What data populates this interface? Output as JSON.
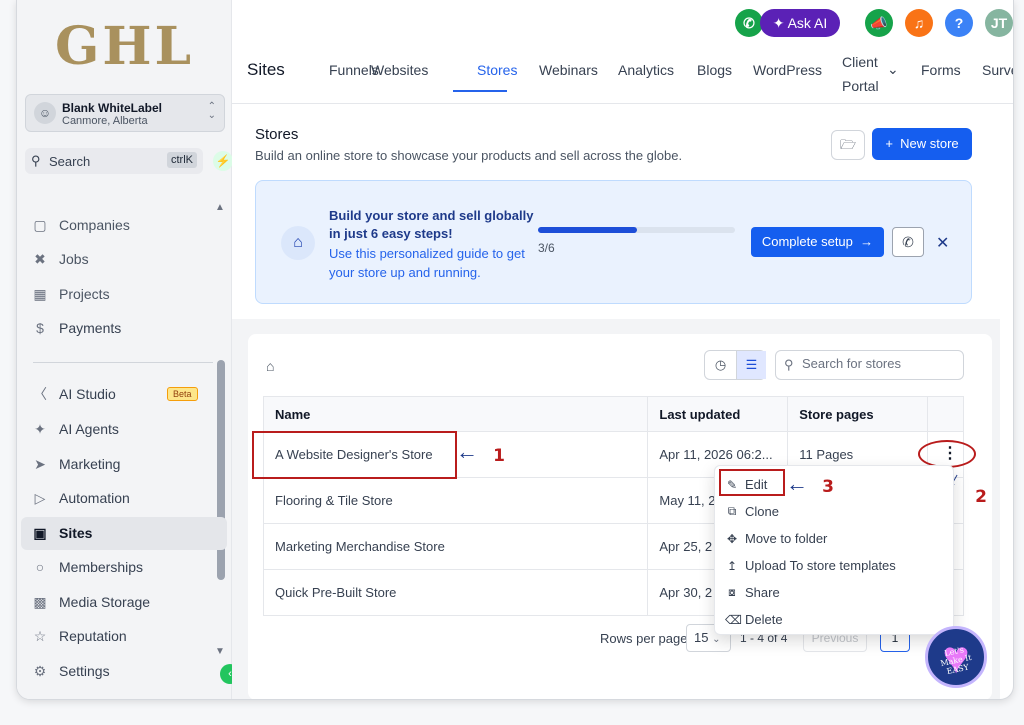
{
  "sidebar": {
    "logo": "GHL",
    "account_name": "Blank WhiteLabel",
    "account_location": "Canmore, Alberta",
    "search_label": "Search",
    "search_shortcut": "ctrlK",
    "items": [
      {
        "label": "Companies",
        "icon": "building-icon"
      },
      {
        "label": "Jobs",
        "icon": "tools-icon"
      },
      {
        "label": "Projects",
        "icon": "calendar-icon"
      },
      {
        "label": "Payments",
        "icon": "receipt-icon"
      },
      {
        "label": "AI Studio",
        "icon": "ai-studio-icon",
        "badge": "Beta"
      },
      {
        "label": "AI Agents",
        "icon": "sparkle-icon"
      },
      {
        "label": "Marketing",
        "icon": "send-icon"
      },
      {
        "label": "Automation",
        "icon": "automation-icon"
      },
      {
        "label": "Sites",
        "icon": "sites-icon",
        "active": true
      },
      {
        "label": "Memberships",
        "icon": "award-icon"
      },
      {
        "label": "Media Storage",
        "icon": "image-icon"
      },
      {
        "label": "Reputation",
        "icon": "star-icon"
      },
      {
        "label": "Settings",
        "icon": "gear-icon"
      }
    ]
  },
  "topbar": {
    "ask_ai": "Ask AI",
    "avatar_initials": "JT",
    "help": "?",
    "page_title": "Sites",
    "tabs": [
      "Funnels",
      "Websites",
      "Stores",
      "Webinars",
      "Analytics",
      "Blogs",
      "WordPress",
      "Client",
      "Portal",
      "Forms",
      "Surveys"
    ],
    "active_tab": "Stores"
  },
  "stores": {
    "title": "Stores",
    "subtitle": "Build an online store to showcase your products and sell across the globe.",
    "new_store": "New store",
    "guide": {
      "line1": "Build your store and sell globally in just 6 easy steps!",
      "line2": "Use this personalized guide to get your store up and running.",
      "progress_fraction": 0.5,
      "progress_text": "3/6",
      "complete_button": "Complete setup"
    },
    "search_placeholder": "Search for stores",
    "columns": [
      "Name",
      "Last updated",
      "Store pages"
    ],
    "rows": [
      {
        "name": "A Website Designer's Store",
        "updated": "Apr 11, 2026 06:2...",
        "pages": "11 Pages"
      },
      {
        "name": "Flooring & Tile Store",
        "updated": "May 11, 2",
        "pages": ""
      },
      {
        "name": "Marketing Merchandise Store",
        "updated": "Apr 25, 2",
        "pages": ""
      },
      {
        "name": "Quick Pre-Built Store",
        "updated": "Apr 30, 2",
        "pages": ""
      }
    ],
    "rows_per_page_label": "Rows per page",
    "rows_per_page_value": "15",
    "range": "1 - 4 of 4",
    "previous": "Previous",
    "page": "1"
  },
  "menu": {
    "items": [
      "Edit",
      "Clone",
      "Move to folder",
      "Upload To store templates",
      "Share",
      "Delete"
    ]
  },
  "annotations": {
    "n1": "1",
    "n2": "2",
    "n3": "3"
  },
  "badge_logo_text": "Let's Make It EASY",
  "colors": {
    "primary": "#155eef",
    "annotation": "#b91c1c",
    "logo": "#a9915e"
  }
}
